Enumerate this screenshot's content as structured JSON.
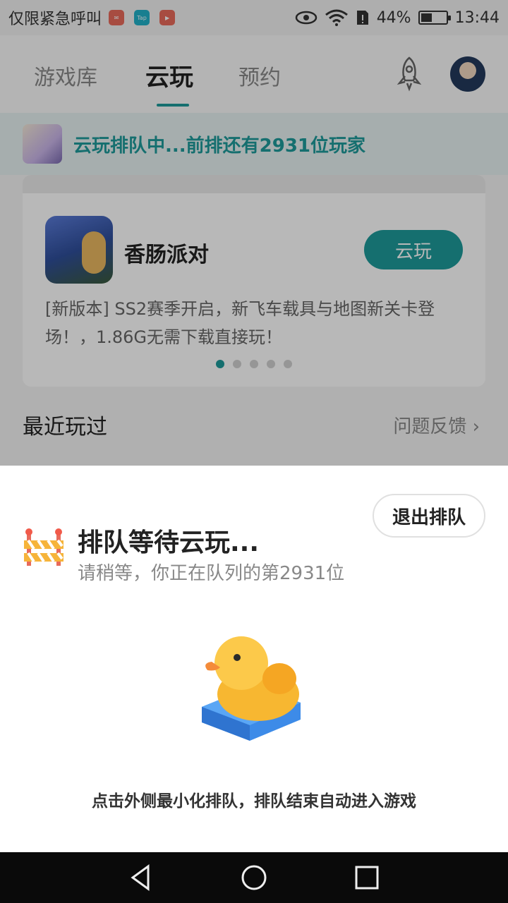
{
  "status_bar": {
    "carrier": "仅限紧急呼叫",
    "app_icons": [
      "mail-icon",
      "tap-icon",
      "video-icon"
    ],
    "tap_label": "Tap",
    "battery": "44%",
    "battery_level": 0.44,
    "time": "13:44"
  },
  "nav": {
    "tabs": [
      {
        "label": "游戏库",
        "active": false
      },
      {
        "label": "云玩",
        "active": true
      },
      {
        "label": "预约",
        "active": false
      }
    ]
  },
  "queue_banner": {
    "text": "云玩排队中...前排还有2931位玩家"
  },
  "featured": {
    "game_name": "香肠派对",
    "play_label": "云玩",
    "description": "[新版本] SS2赛季开启，新飞车载具与地图新关卡登场！，1.86G无需下载直接玩！",
    "carousel_count": 5,
    "carousel_active": 0
  },
  "recent": {
    "title": "最近玩过",
    "feedback_label": "问题反馈"
  },
  "sheet": {
    "title": "排队等待云玩...",
    "subtitle": "请稍等，你正在队列的第2931位",
    "exit_label": "退出排队",
    "hint": "点击外侧最小化排队，排队结束自动进入游戏"
  },
  "colors": {
    "accent": "#1e9a9a",
    "nav_bar": "#0a0a0a"
  }
}
